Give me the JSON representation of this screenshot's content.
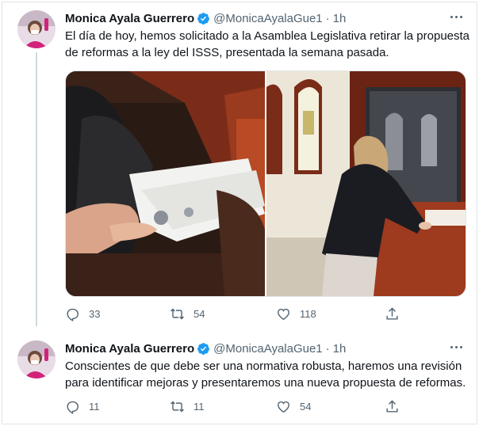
{
  "tweets": [
    {
      "author_name": "Monica Ayala Guerrero",
      "handle": "@MonicaAyalaGue1",
      "separator": "·",
      "time": "1h",
      "text": "El día de hoy, hemos solicitado a la Asamblea Legislativa retirar la propuesta de reformas a la ley del ISSS, presentada la semana pasada.",
      "replies": "33",
      "retweets": "54",
      "likes": "118"
    },
    {
      "author_name": "Monica Ayala Guerrero",
      "handle": "@MonicaAyalaGue1",
      "separator": "·",
      "time": "1h",
      "text": "Conscientes de que debe ser una normativa robusta, haremos una revisión para identificar mejoras y presentaremos una nueva propuesta de reformas.",
      "replies": "11",
      "retweets": "11",
      "likes": "54"
    }
  ],
  "icons": {
    "verified": "verified-badge-icon",
    "more": "more-options-icon",
    "reply": "reply-icon",
    "retweet": "retweet-icon",
    "like": "heart-icon",
    "share": "share-icon"
  },
  "colors": {
    "verified": "#1d9bf0",
    "secondary_text": "#536471",
    "thread_line": "#cfd9de"
  }
}
